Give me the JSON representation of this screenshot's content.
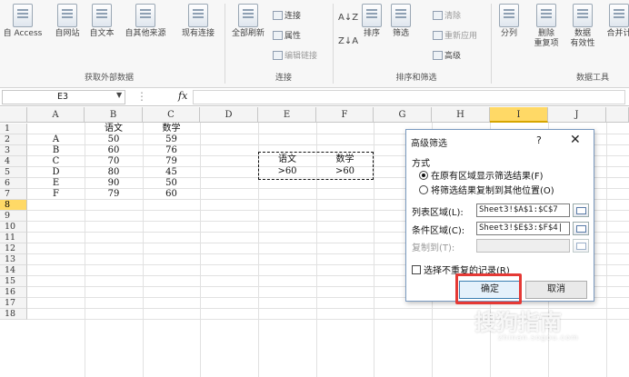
{
  "ribbon": {
    "external": {
      "access": "自 Access",
      "web": "自网站",
      "text": "自文本",
      "other": "自其他来源",
      "existing": "现有连接",
      "group_label": "获取外部数据"
    },
    "connections": {
      "refresh_all": "全部刷新",
      "connections": "连接",
      "properties": "属性",
      "edit_links": "编辑链接",
      "group_label": "连接"
    },
    "sort_filter": {
      "sort": "排序",
      "filter": "筛选",
      "clear": "清除",
      "reapply": "重新应用",
      "advanced": "高级",
      "group_label": "排序和筛选"
    },
    "data_tools": {
      "split": "分列",
      "remove_dup": "删除\n重复项",
      "validation": "数据\n有效性",
      "consolidate": "合并计",
      "group_label": "数据工具"
    }
  },
  "formula_bar": {
    "name_box": "E3",
    "fx": "fx",
    "formula": ""
  },
  "sheet": {
    "columns": [
      "A",
      "B",
      "C",
      "D",
      "E",
      "F",
      "G",
      "H",
      "I",
      "J"
    ],
    "selected_column": "I",
    "rows": [
      "1",
      "2",
      "3",
      "4",
      "5",
      "6",
      "7",
      "8",
      "9",
      "10",
      "11",
      "12",
      "13",
      "14",
      "15",
      "16",
      "17",
      "18"
    ],
    "selected_row": "8",
    "table": {
      "header": [
        "",
        "语文",
        "数学"
      ],
      "data": [
        [
          "A",
          "50",
          "59"
        ],
        [
          "B",
          "60",
          "76"
        ],
        [
          "C",
          "70",
          "79"
        ],
        [
          "D",
          "80",
          "45"
        ],
        [
          "E",
          "90",
          "50"
        ],
        [
          "F",
          "79",
          "60"
        ]
      ]
    },
    "criteria": {
      "header": [
        "语文",
        "数学"
      ],
      "values": [
        ">60",
        ">60"
      ]
    }
  },
  "dialog": {
    "title": "高级筛选",
    "help": "?",
    "close": "✕",
    "mode_label": "方式",
    "option_inplace": "在原有区域显示筛选结果(F)",
    "option_copy": "将筛选结果复制到其他位置(O)",
    "list_range_label": "列表区域(L):",
    "list_range_value": "Sheet3!$A$1:$C$7",
    "criteria_range_label": "条件区域(C):",
    "criteria_range_value": "Sheet3!$E$3:$F$4|",
    "copy_to_label": "复制到(T):",
    "copy_to_value": "",
    "unique_label": "选择不重复的记录(R)",
    "ok": "确定",
    "cancel": "取消"
  },
  "watermark": {
    "brand": "搜狗指南",
    "url": "zhinan.sogou.com"
  }
}
